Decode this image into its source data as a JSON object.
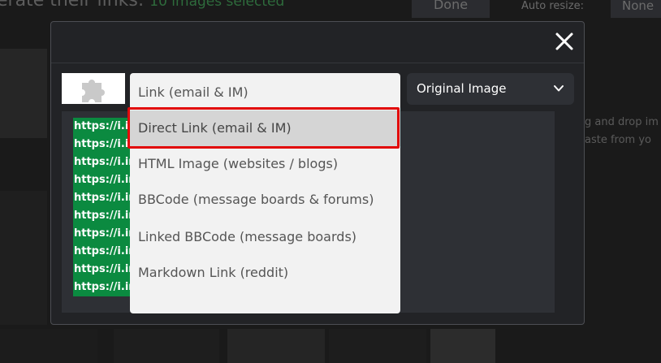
{
  "background": {
    "title": "erate their links:",
    "selected_count": "10 images selected",
    "done_label": "Done",
    "auto_resize_label": "Auto resize:",
    "auto_resize_value": "None",
    "hint_line1": "g and drop im",
    "hint_line2": "aste from yo"
  },
  "modal": {
    "close_icon": "close-icon",
    "plugin_icon": "puzzle-icon",
    "size_select": {
      "value": "Original Image",
      "icon": "chevron-down-icon"
    },
    "links": [
      "https://i.i",
      "https://i.i",
      "https://i.ir",
      "https://i.ir",
      "https://i.ir",
      "https://i.ir",
      "https://i.ir",
      "https://i.ir",
      "https://i.ir",
      "https://i.ir"
    ]
  },
  "link_type_dropdown": {
    "selected": "Direct Link (email & IM)",
    "options": [
      "Link (email & IM)",
      "Direct Link (email & IM)",
      "HTML Image (websites / blogs)",
      "BBCode (message boards & forums)",
      "Linked BBCode (message boards)",
      "Markdown Link (reddit)"
    ]
  },
  "colors": {
    "link_highlight": "#0b8a40",
    "annotation_box": "#e20a0a",
    "modal_bg": "#222326"
  }
}
